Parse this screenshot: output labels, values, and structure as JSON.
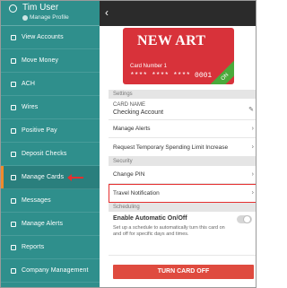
{
  "user": {
    "name": "Tim User",
    "profile_link": "Manage Profile"
  },
  "sidebar": {
    "items": [
      {
        "label": "View Accounts",
        "icon": "bank-icon"
      },
      {
        "label": "Move Money",
        "icon": "transfer-icon"
      },
      {
        "label": "ACH",
        "icon": "ach-icon"
      },
      {
        "label": "Wires",
        "icon": "wire-icon"
      },
      {
        "label": "Positive Pay",
        "icon": "shield-icon"
      },
      {
        "label": "Deposit Checks",
        "icon": "check-icon"
      },
      {
        "label": "Manage Cards",
        "icon": "card-icon",
        "active": true
      },
      {
        "label": "Messages",
        "icon": "message-icon"
      },
      {
        "label": "Manage Alerts",
        "icon": "alert-icon"
      },
      {
        "label": "Reports",
        "icon": "report-icon"
      },
      {
        "label": "Company Management",
        "icon": "company-icon"
      }
    ]
  },
  "topbar": {
    "back_glyph": "‹"
  },
  "card": {
    "art_text": "NEW ART",
    "number_label": "Card Number 1",
    "number_masked": "**** **** **** 0001",
    "status_badge": "ON"
  },
  "settings": {
    "section_title": "Settings",
    "card_name_label": "CARD NAME",
    "card_name_value": "Checking Account",
    "manage_alerts": "Manage Alerts",
    "spending_limit": "Request Temporary Spending Limit Increase"
  },
  "security": {
    "section_title": "Security",
    "change_pin": "Change PIN",
    "travel_notification": "Travel Notification"
  },
  "scheduling": {
    "section_title": "Scheduling",
    "auto_toggle_label": "Enable Automatic On/Off",
    "auto_toggle_desc": "Set up a schedule to automatically turn this card on and off for specific days and times.",
    "auto_toggle_on": false
  },
  "actions": {
    "turn_off_label": "TURN CARD OFF"
  },
  "colors": {
    "sidebar": "#2f8f8c",
    "card": "#d8323a",
    "on_badge": "#4aaa3b",
    "primary_button": "#df4b3f",
    "highlight": "#e52f2f"
  }
}
